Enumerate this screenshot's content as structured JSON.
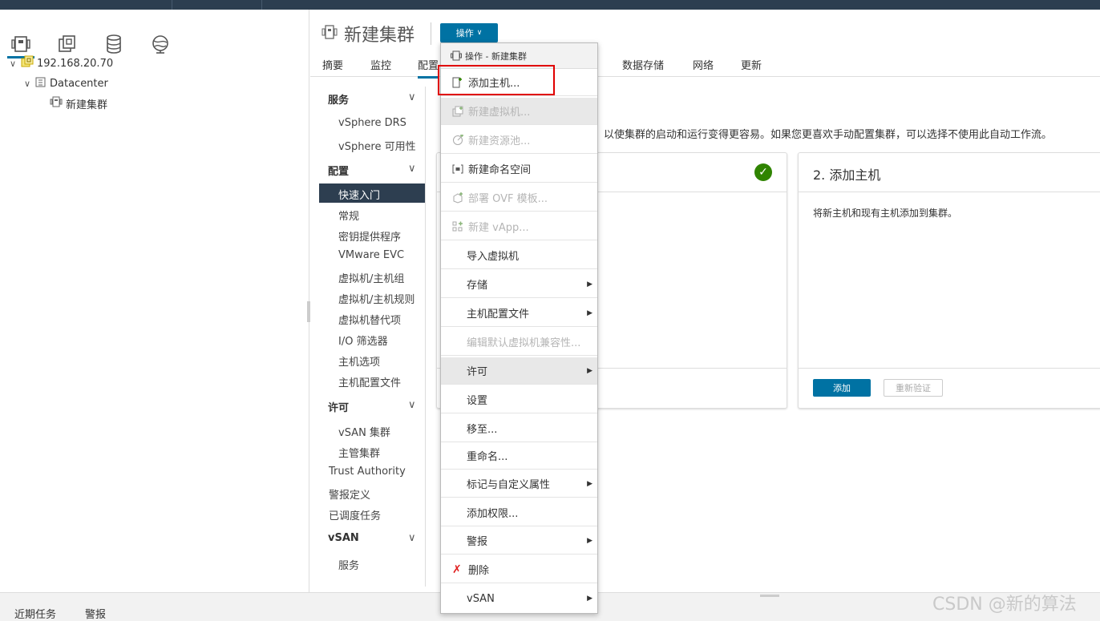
{
  "inventory": {
    "tabs": [
      "hosts-and-clusters",
      "vms-and-templates",
      "storage",
      "networking"
    ],
    "tree": [
      {
        "label": "192.168.20.70",
        "icon": "vcenter-icon"
      },
      {
        "label": "Datacenter",
        "icon": "datacenter-icon"
      },
      {
        "label": "新建集群",
        "icon": "cluster-icon"
      }
    ]
  },
  "header": {
    "title": "新建集群",
    "actions_label": "操作",
    "tabs": [
      "摘要",
      "监控",
      "配置",
      "数据存储",
      "网络",
      "更新"
    ]
  },
  "settings_nav": {
    "services": {
      "label": "服务",
      "items": [
        "vSphere DRS",
        "vSphere 可用性"
      ]
    },
    "config": {
      "label": "配置",
      "items": [
        "快速入门",
        "常规",
        "密钥提供程序",
        "VMware EVC",
        "虚拟机/主机组",
        "虚拟机/主机规则",
        "虚拟机替代项",
        "I/O 筛选器",
        "主机选项",
        "主机配置文件"
      ]
    },
    "license": {
      "label": "许可",
      "items": [
        "vSAN 集群",
        "主管集群"
      ]
    },
    "top_items": [
      "Trust Authority",
      "警报定义",
      "已调度任务"
    ],
    "vsan": {
      "label": "vSAN",
      "items": [
        "服务"
      ]
    }
  },
  "content": {
    "description": "以使集群的启动和运行变得更容易。如果您更喜欢手动配置集群，可以选择不使用此自动工作流。",
    "card2": {
      "title": "2. 添加主机",
      "body": "将新主机和现有主机添加到集群。",
      "add_label": "添加",
      "revalidate_label": "重新验证"
    }
  },
  "menu": {
    "header": "操作 - 新建集群",
    "items": [
      {
        "label": "添加主机...",
        "icon": "add-host-icon",
        "disabled": false,
        "submenu": false
      },
      {
        "label": "新建虚拟机...",
        "icon": "new-vm-icon",
        "disabled": true,
        "submenu": false
      },
      {
        "label": "新建资源池...",
        "icon": "resource-pool-icon",
        "disabled": true,
        "submenu": false
      },
      {
        "label": "新建命名空间",
        "icon": "namespace-icon",
        "disabled": false,
        "submenu": false
      },
      {
        "label": "部署 OVF 模板...",
        "icon": "ovf-icon",
        "disabled": true,
        "submenu": false
      },
      {
        "label": "新建 vApp...",
        "icon": "vapp-icon",
        "disabled": true,
        "submenu": false
      },
      {
        "label": "导入虚拟机",
        "icon": "",
        "disabled": false,
        "submenu": false
      },
      {
        "label": "存储",
        "icon": "",
        "disabled": false,
        "submenu": true
      },
      {
        "label": "主机配置文件",
        "icon": "",
        "disabled": false,
        "submenu": true
      },
      {
        "label": "编辑默认虚拟机兼容性...",
        "icon": "",
        "disabled": true,
        "submenu": false
      },
      {
        "label": "许可",
        "icon": "",
        "disabled": false,
        "submenu": true
      },
      {
        "label": "设置",
        "icon": "",
        "disabled": false,
        "submenu": false
      },
      {
        "label": "移至...",
        "icon": "",
        "disabled": false,
        "submenu": false
      },
      {
        "label": "重命名...",
        "icon": "",
        "disabled": false,
        "submenu": false
      },
      {
        "label": "标记与自定义属性",
        "icon": "",
        "disabled": false,
        "submenu": true
      },
      {
        "label": "添加权限...",
        "icon": "",
        "disabled": false,
        "submenu": false
      },
      {
        "label": "警报",
        "icon": "",
        "disabled": false,
        "submenu": true
      },
      {
        "label": "删除",
        "icon": "delete-icon",
        "disabled": false,
        "submenu": false
      },
      {
        "label": "vSAN",
        "icon": "",
        "disabled": false,
        "submenu": true
      }
    ]
  },
  "bottom": {
    "recent_tasks": "近期任务",
    "alarms": "警报"
  },
  "watermark": "CSDN @新的算法",
  "colors": {
    "accent": "#0072a3",
    "nav_selected": "#2d3e50",
    "check": "#2f8400",
    "highlight_box": "#e00000"
  }
}
